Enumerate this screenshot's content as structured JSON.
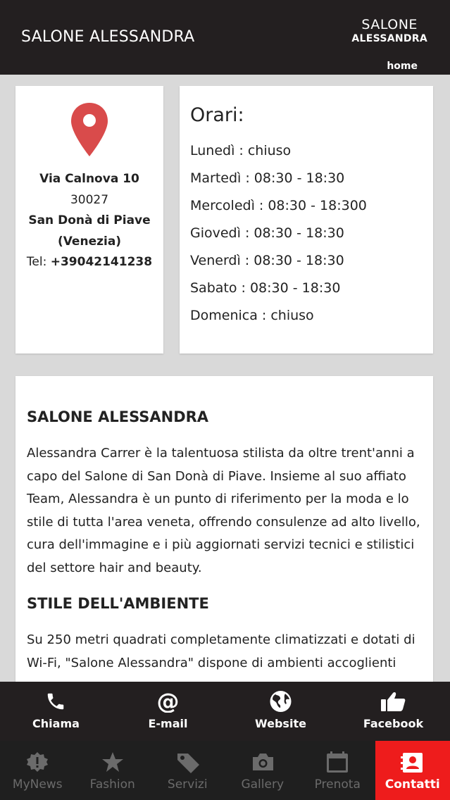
{
  "header": {
    "title": "SALONE ALESSANDRA",
    "logo_line1": "SALONE",
    "logo_line2": "ALESSANDRA",
    "home_link": "home"
  },
  "address": {
    "street": "Via Calnova 10",
    "zip": "30027",
    "city": "San Donà di Piave",
    "province": "(Venezia)",
    "tel_label": "Tel: ",
    "tel_number": "+39042141238"
  },
  "hours": {
    "title": "Orari:",
    "rows": [
      "Lunedì : chiuso",
      "Martedì : 08:30 - 18:30",
      "Mercoledì : 08:30 - 18:300",
      "Giovedì : 08:30 - 18:30",
      "Venerdì : 08:30 - 18:30",
      "Sabato : 08:30 - 18:30",
      "Domenica : chiuso"
    ]
  },
  "about": {
    "heading1": "SALONE ALESSANDRA",
    "paragraph1": "Alessandra Carrer è la talentuosa stilista da oltre trent'anni a capo del Salone di San Donà di Piave. Insieme al suo affiato Team, Alessandra è un punto di riferimento per la moda e lo stile di tutta l'area veneta, offrendo consulenze ad alto livello, cura dell'immagine e i più aggiornati servizi tecnici e stilistici del settore hair and beauty.",
    "heading2": "STILE DELL'AMBIENTE",
    "paragraph2": "Su 250 metri quadrati completamente climatizzati e dotati di Wi-Fi, \"Salone Alessandra\" dispone di ambienti accoglienti"
  },
  "actions": [
    {
      "label": "Chiama",
      "icon": "phone-icon"
    },
    {
      "label": "E-mail",
      "icon": "at-sign-icon"
    },
    {
      "label": "Website",
      "icon": "globe-icon"
    },
    {
      "label": "Facebook",
      "icon": "thumbs-up-icon"
    }
  ],
  "tabs": [
    {
      "label": "MyNews",
      "icon": "news-badge-icon"
    },
    {
      "label": "Fashion",
      "icon": "star-icon"
    },
    {
      "label": "Servizi",
      "icon": "tag-icon"
    },
    {
      "label": "Gallery",
      "icon": "camera-icon"
    },
    {
      "label": "Prenota",
      "icon": "calendar-icon"
    },
    {
      "label": "Contatti",
      "icon": "contact-card-icon",
      "active": true
    }
  ],
  "colors": {
    "header_bg": "#231f20",
    "pin": "#d94b4b",
    "active_tab": "#ee1c1c",
    "inactive_tab_text": "#6b6b6b",
    "page_bg": "#d9d9d9"
  }
}
